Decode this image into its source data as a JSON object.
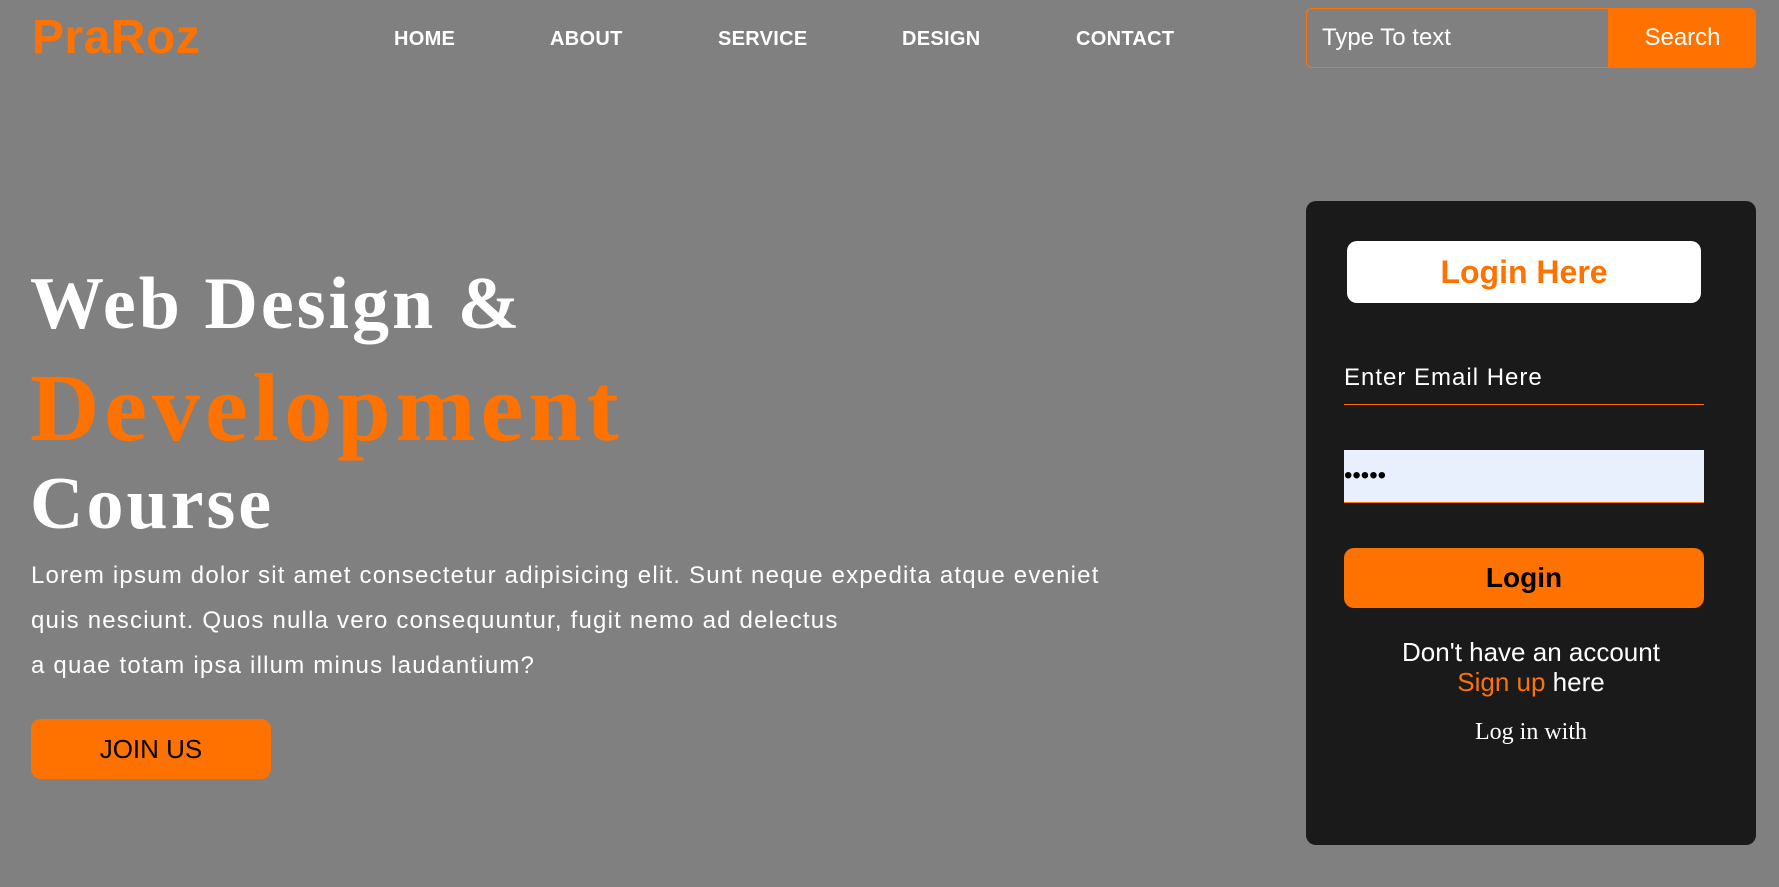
{
  "header": {
    "logo": "PraRoz",
    "nav": [
      "HOME",
      "ABOUT",
      "SERVICE",
      "DESIGN",
      "CONTACT"
    ],
    "search": {
      "placeholder": "Type To text",
      "button_label": "Search"
    }
  },
  "hero": {
    "line1": "Web Design &",
    "line2": "Development",
    "line3": "Course",
    "paragraph": [
      "Lorem ipsum dolor sit amet consectetur adipisicing elit. Sunt neque expedita atque eveniet",
      "quis nesciunt. Quos nulla vero consequuntur, fugit nemo ad delectus",
      "a quae totam ipsa illum minus laudantium?"
    ],
    "join_label": "JOIN US"
  },
  "login": {
    "title": "Login Here",
    "email_placeholder": "Enter Email Here",
    "password_value": "•••••",
    "button_label": "Login",
    "no_account": "Don't have an account",
    "signup_link": "Sign up",
    "signup_suffix": " here",
    "login_with": "Log in with"
  },
  "colors": {
    "accent": "#ff7200",
    "background": "#808080",
    "card": "#1a1a1a",
    "autofill": "#e8f0fe"
  }
}
